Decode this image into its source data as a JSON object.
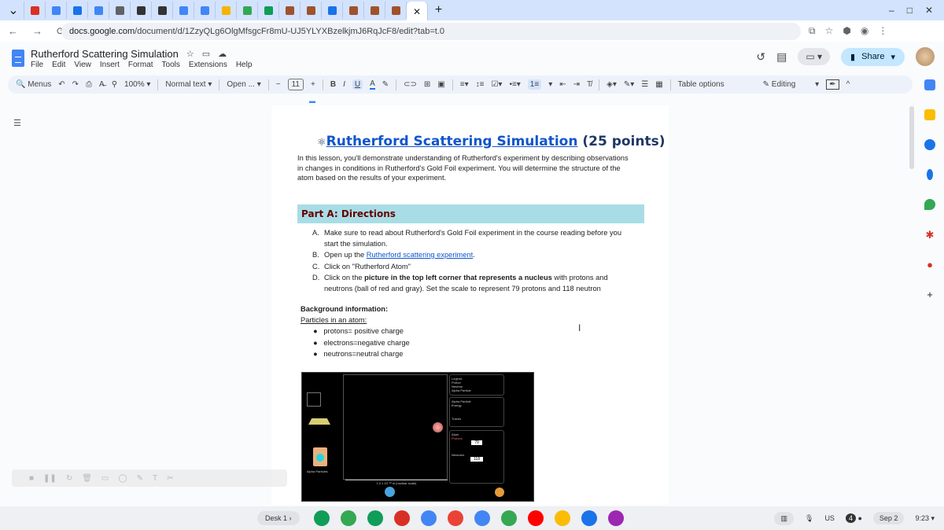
{
  "browser": {
    "url_domain": "docs.google.com",
    "url_path": "/document/d/1ZzyQLg6OlgMfsgcFr8mU-UJ5YLYXBzelkjmJ6RqJcF8/edit?tab=t.0",
    "tab_colors": [
      "#d93025",
      "#4285f4",
      "#1a73e8",
      "#4285f4",
      "#5f6368",
      "#333333",
      "#333333",
      "#4285f4",
      "#4285f4",
      "#f4b400",
      "#34a853",
      "#0f9d58",
      "#a0522d",
      "#a0522d",
      "#1a73e8",
      "#a0522d",
      "#a0522d",
      "#a0522d"
    ],
    "tab_close": "✕",
    "new_tab": "+"
  },
  "doc": {
    "title": "Rutherford Scattering Simulation",
    "menus": [
      "File",
      "Edit",
      "View",
      "Insert",
      "Format",
      "Tools",
      "Extensions",
      "Help"
    ],
    "share_label": "Share"
  },
  "toolbar": {
    "search": "Menus",
    "zoom": "100%",
    "style": "Normal text",
    "font": "Open ...",
    "size": "11",
    "table_options": "Table options",
    "mode": "Editing"
  },
  "content": {
    "heading_link": "Rutherford Scattering Simulation",
    "heading_rest": " (25 points)",
    "intro": "In this lesson, you'll demonstrate understanding of Rutherford's experiment by describing observations in changes in conditions in Rutherford's Gold Foil experiment. You will determine the structure of the atom based on the results of your experiment.",
    "part_heading": "Part A: Directions",
    "steps": [
      {
        "marker": "A.",
        "text": "Make sure to read about Rutherford's Gold Foil experiment in the course reading before you start the simulation."
      },
      {
        "marker": "B.",
        "pre": "Open up the ",
        "link": "Rutherford scattering experiment",
        "post": "."
      },
      {
        "marker": "C.",
        "text": "Click on \"Rutherford Atom\""
      },
      {
        "marker": "D.",
        "pre": "Click on the ",
        "bold": "picture in the top left corner that represents a nucleus",
        "post": " with protons and neutrons (ball of red and gray). Set the scale to represent 79 protons and 118 neutron"
      }
    ],
    "bg_heading": "Background information:",
    "bg_sub": "Particles in an atom:",
    "bullets": [
      "protons= positive charge",
      "electrons=negative charge",
      "neutrons=neutral charge"
    ],
    "sim": {
      "legend": "Legend",
      "legend_items": [
        "Proton",
        "Neutron",
        "Alpha Particle"
      ],
      "alpha_panel": "Alpha Particle",
      "energy": "Energy",
      "traces": "Traces",
      "atom_panel": "Atom",
      "protons_label": "Protons",
      "protons": "79",
      "neutrons_label": "Neutrons",
      "neutrons": "118",
      "gun_label": "Alpha Particles",
      "scale": "1.2 x 10⁻¹³ m (nuclear scale)"
    }
  },
  "shelf": {
    "desk": "Desk 1",
    "locale": "US",
    "notifications": "4",
    "date": "Sep 2",
    "time": "9:23",
    "app_colors": [
      "#0f9d58",
      "#34a853",
      "#0f9d58",
      "#d93025",
      "#4285f4",
      "#ea4335",
      "#4285f4",
      "#34a853",
      "#ff0000",
      "#fbbc04",
      "#1a73e8",
      "#9c27b0"
    ]
  }
}
